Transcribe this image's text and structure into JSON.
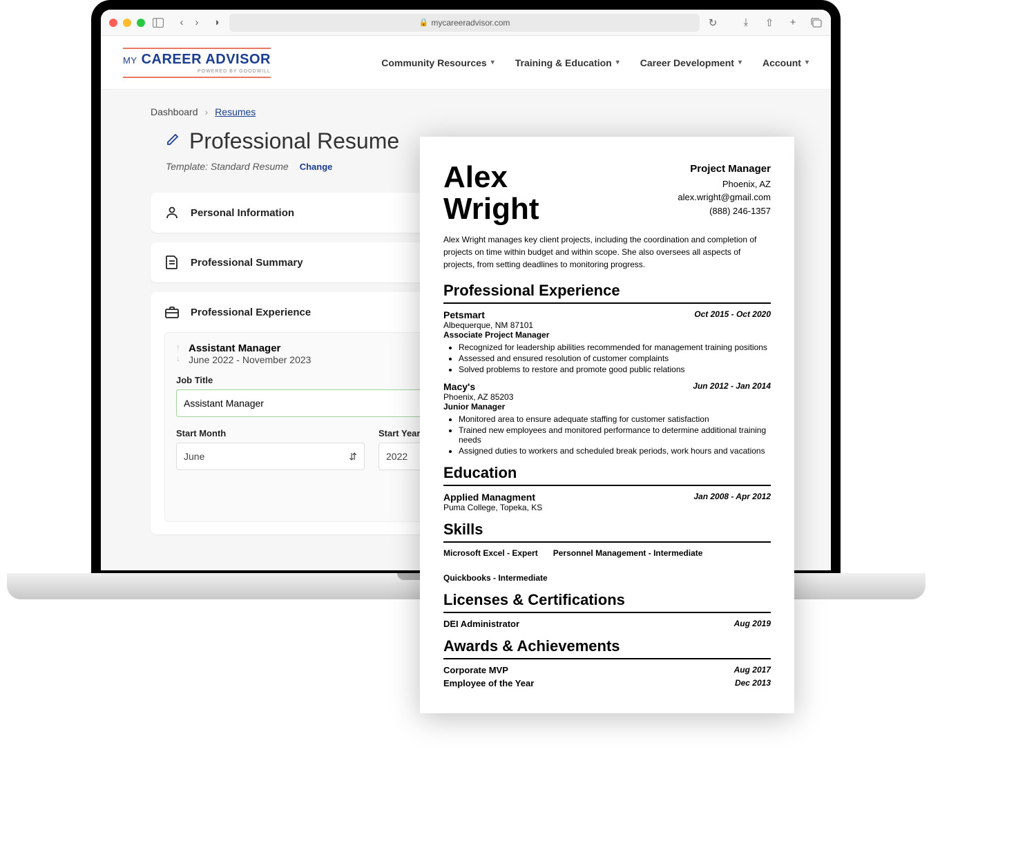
{
  "browser": {
    "url": "mycareeradvisor.com"
  },
  "header": {
    "logo_prefix": "MY",
    "logo_main": "CAREER ADVISOR",
    "logo_sub": "POWERED BY GOODWILL"
  },
  "nav": {
    "items": [
      "Community Resources",
      "Training & Education",
      "Career Development",
      "Account"
    ]
  },
  "breadcrumb": {
    "root": "Dashboard",
    "current": "Resumes"
  },
  "page": {
    "title": "Professional Resume",
    "template_label": "Template: Standard Resume",
    "change_label": "Change"
  },
  "sections": {
    "personal": "Personal Information",
    "summary": "Professional Summary",
    "experience": "Professional Experience"
  },
  "experience_entry": {
    "title": "Assistant Manager",
    "dates": "June 2022 - November 2023",
    "job_title_label": "Job Title",
    "job_title_value": "Assistant Manager",
    "start_month_label": "Start Month",
    "start_month_value": "June",
    "start_year_label": "Start Year",
    "start_year_value": "2022"
  },
  "resume": {
    "name_first": "Alex",
    "name_last": "Wright",
    "role": "Project Manager",
    "location": "Phoenix,  AZ",
    "email": "alex.wright@gmail.com",
    "phone": "(888) 246-1357",
    "summary": "Alex Wright manages key client projects, including the coordination and completion of projects on time within budget and within scope. She also oversees all aspects of projects, from setting deadlines to monitoring progress.",
    "sections": {
      "experience": "Professional Experience",
      "education": "Education",
      "skills": "Skills",
      "licenses": "Licenses & Certifications",
      "awards": "Awards & Achievements"
    },
    "jobs": [
      {
        "company": "Petsmart",
        "dates": "Oct 2015 - Oct 2020",
        "location": "Albequerque, NM 87101",
        "title": "Associate Project Manager",
        "bullets": [
          "Recognized for leadership abilities recommended for management training positions",
          "Assessed and ensured resolution of customer complaints",
          "Solved problems to restore and promote good public relations"
        ]
      },
      {
        "company": "Macy's",
        "dates": "Jun 2012 - Jan 2014",
        "location": "Phoenix, AZ 85203",
        "title": "Junior Manager",
        "bullets": [
          "Monitored area to ensure adequate staffing for customer satisfaction",
          "Trained new employees and monitored performance to determine additional training needs",
          "Assigned duties to workers and scheduled break periods, work hours and vacations"
        ]
      }
    ],
    "education": {
      "degree": "Applied Managment",
      "school": "Puma College, Topeka, KS",
      "dates": "Jan 2008 - Apr 2012"
    },
    "skills": [
      "Microsoft Excel - Expert",
      "Personnel Management - Intermediate",
      "Quickbooks - Intermediate"
    ],
    "licenses": [
      {
        "name": "DEI Administrator",
        "date": "Aug 2019"
      }
    ],
    "awards": [
      {
        "name": "Corporate MVP",
        "date": "Aug 2017"
      },
      {
        "name": "Employee of the Year",
        "date": "Dec 2013"
      }
    ]
  }
}
